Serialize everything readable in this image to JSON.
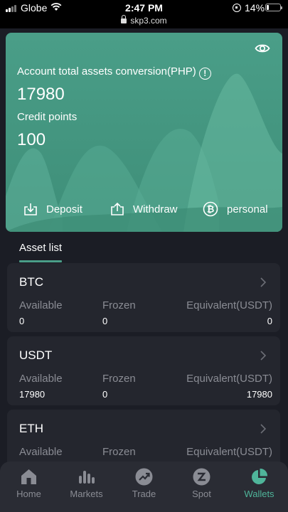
{
  "status_bar": {
    "carrier": "Globe",
    "time": "2:47 PM",
    "url": "skp3.com",
    "battery": "14%"
  },
  "account": {
    "assets_label": "Account total assets conversion(PHP)",
    "assets_value": "17980",
    "credit_label": "Credit points",
    "credit_value": "100",
    "actions": {
      "deposit": "Deposit",
      "withdraw": "Withdraw",
      "personal": "personal"
    }
  },
  "asset_list": {
    "tab_label": "Asset list",
    "columns": {
      "available": "Available",
      "frozen": "Frozen",
      "equivalent": "Equivalent(USDT)"
    },
    "items": [
      {
        "name": "BTC",
        "available": "0",
        "frozen": "0",
        "equivalent": "0"
      },
      {
        "name": "USDT",
        "available": "17980",
        "frozen": "0",
        "equivalent": "17980"
      },
      {
        "name": "ETH",
        "available": "",
        "frozen": "",
        "equivalent": ""
      }
    ]
  },
  "nav": {
    "items": [
      {
        "label": "Home",
        "icon": "home-icon"
      },
      {
        "label": "Markets",
        "icon": "bar-chart-icon"
      },
      {
        "label": "Trade",
        "icon": "trend-icon"
      },
      {
        "label": "Spot",
        "icon": "spot-icon"
      },
      {
        "label": "Wallets",
        "icon": "pie-chart-icon",
        "active": true
      }
    ]
  },
  "colors": {
    "accent": "#4a9e88",
    "active_nav": "#4fb59a",
    "background": "#1b1d25",
    "card": "#24262e"
  }
}
